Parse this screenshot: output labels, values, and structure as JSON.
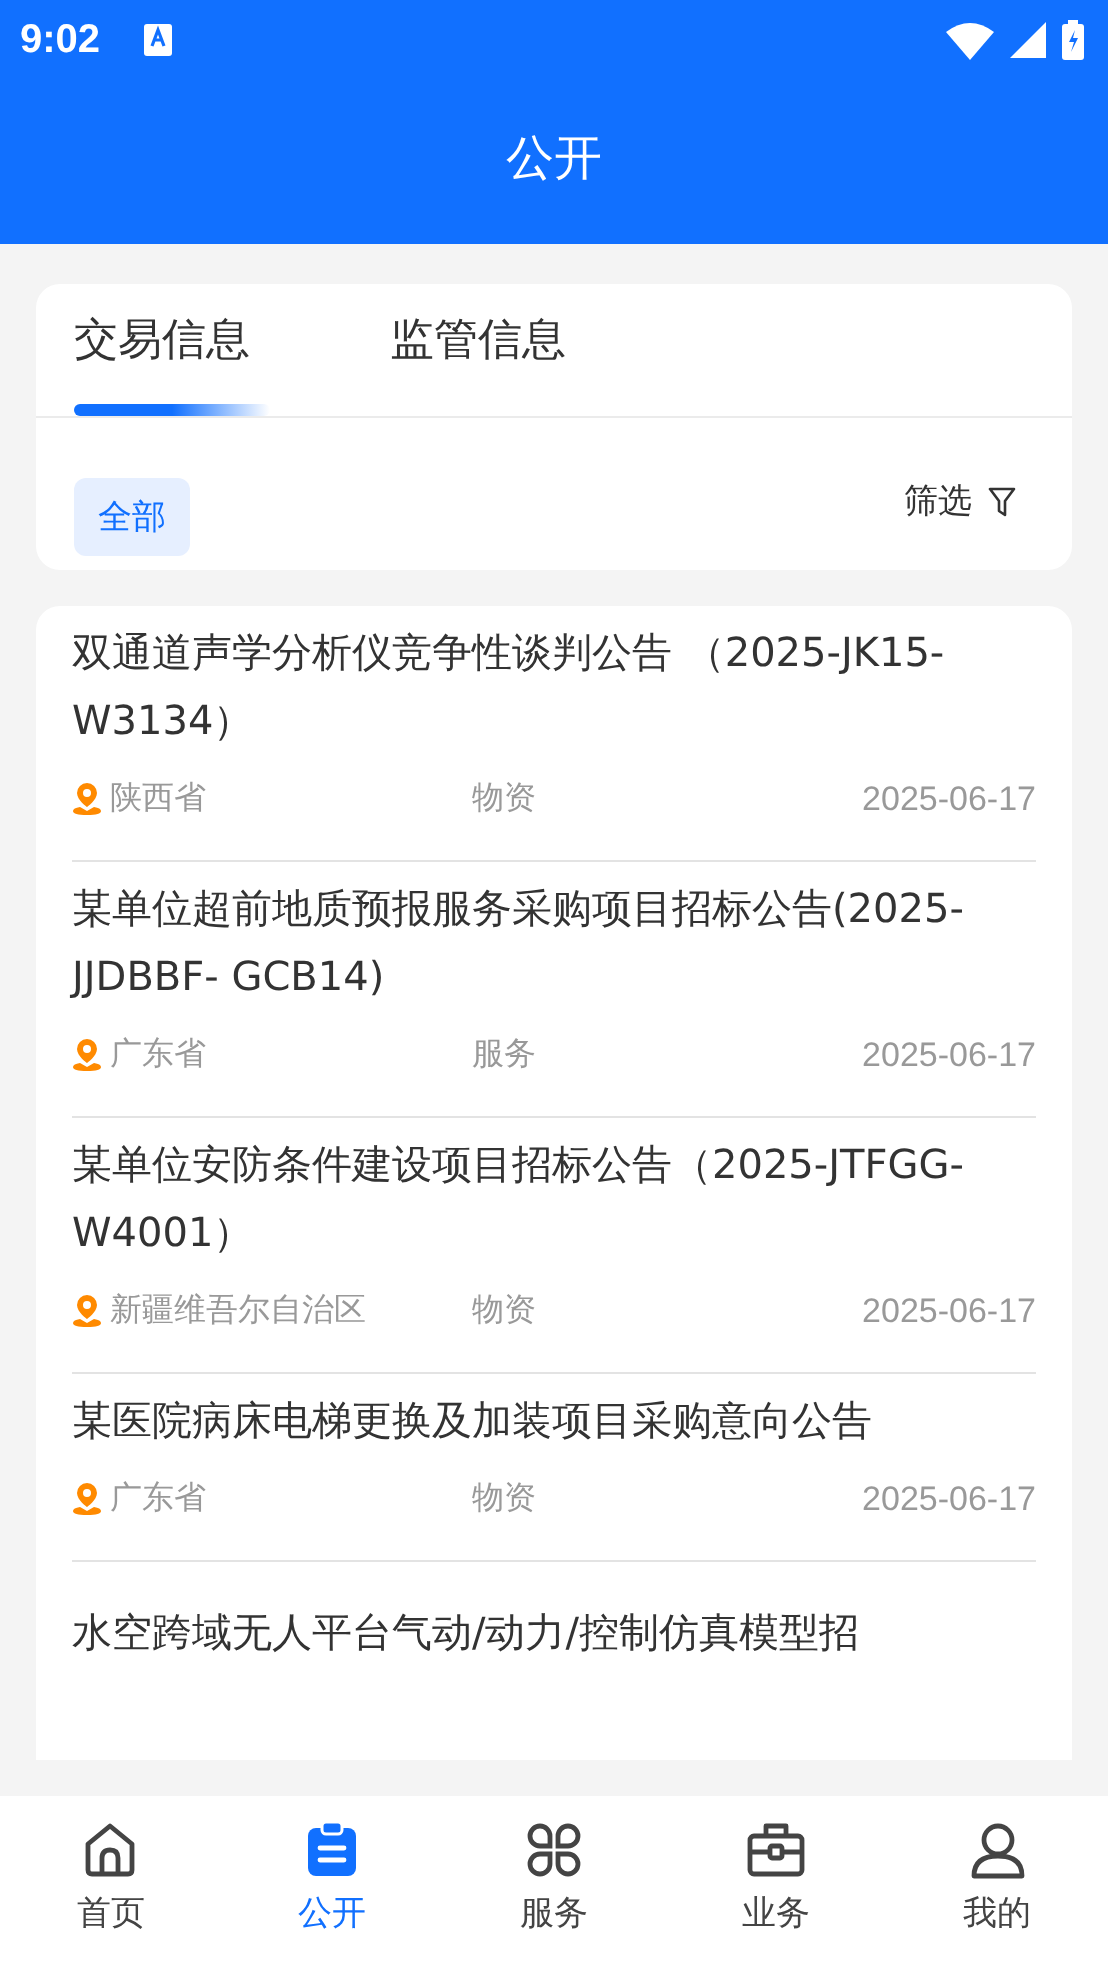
{
  "status_bar": {
    "time": "9:02"
  },
  "header": {
    "title": "公开"
  },
  "tabs": [
    {
      "label": "交易信息",
      "selected": true
    },
    {
      "label": "监管信息",
      "selected": false
    }
  ],
  "filter_chips": [
    {
      "label": "全部",
      "selected": true
    }
  ],
  "filter_button": {
    "label": "筛选"
  },
  "notices": [
    {
      "title": "双通道声学分析仪竞争性谈判公告 （2025-JK15-W3134）",
      "region": "陕西省",
      "category": "物资",
      "date": "2025-06-17"
    },
    {
      "title": "某单位超前地质预报服务采购项目招标公告(2025-JJDBBF- GCB14)",
      "region": "广东省",
      "category": "服务",
      "date": "2025-06-17"
    },
    {
      "title": "某单位安防条件建设项目招标公告（2025-JTFGG-W4001）",
      "region": "新疆维吾尔自治区",
      "category": "物资",
      "date": "2025-06-17"
    },
    {
      "title": "某医院病床电梯更换及加装项目采购意向公告",
      "region": "广东省",
      "category": "物资",
      "date": "2025-06-17"
    },
    {
      "title": "水空跨域无人平台气动/动力/控制仿真模型招"
    }
  ],
  "bottom_nav": [
    {
      "label": "首页",
      "kind": "home",
      "selected": false
    },
    {
      "label": "公开",
      "kind": "clipboard",
      "selected": true
    },
    {
      "label": "服务",
      "kind": "grid",
      "selected": false
    },
    {
      "label": "业务",
      "kind": "toolbox",
      "selected": false
    },
    {
      "label": "我的",
      "kind": "person",
      "selected": false
    }
  ]
}
